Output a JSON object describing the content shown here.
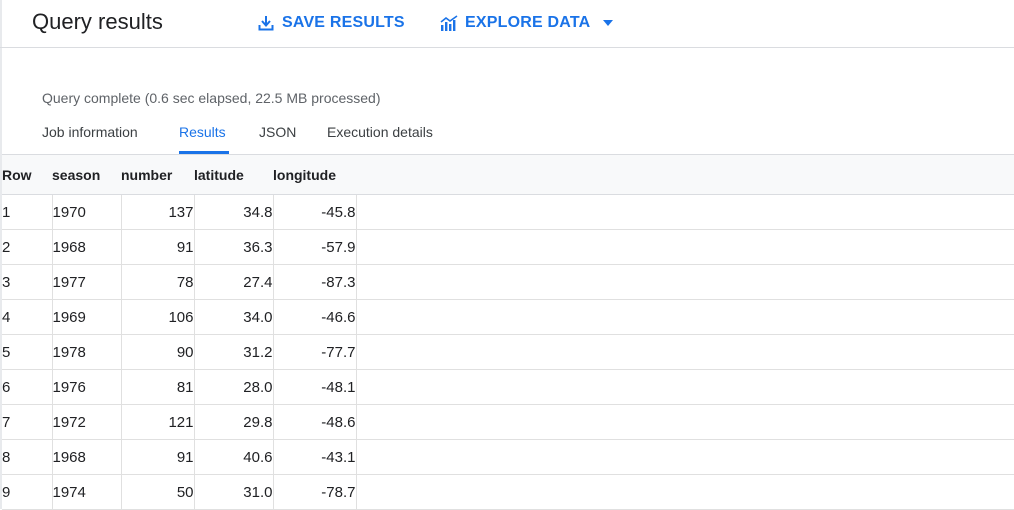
{
  "header": {
    "title": "Query results",
    "save_results_label": "SAVE RESULTS",
    "explore_data_label": "EXPLORE DATA"
  },
  "status": "Query complete (0.6 sec elapsed, 22.5 MB processed)",
  "tabs": [
    {
      "label": "Job information",
      "active": false
    },
    {
      "label": "Results",
      "active": true
    },
    {
      "label": "JSON",
      "active": false
    },
    {
      "label": "Execution details",
      "active": false
    }
  ],
  "table": {
    "columns": [
      "Row",
      "season",
      "number",
      "latitude",
      "longitude"
    ],
    "rows": [
      [
        "1",
        "1970",
        "137",
        "34.8",
        "-45.8"
      ],
      [
        "2",
        "1968",
        "91",
        "36.3",
        "-57.9"
      ],
      [
        "3",
        "1977",
        "78",
        "27.4",
        "-87.3"
      ],
      [
        "4",
        "1969",
        "106",
        "34.0",
        "-46.6"
      ],
      [
        "5",
        "1978",
        "90",
        "31.2",
        "-77.7"
      ],
      [
        "6",
        "1976",
        "81",
        "28.0",
        "-48.1"
      ],
      [
        "7",
        "1972",
        "121",
        "29.8",
        "-48.6"
      ],
      [
        "8",
        "1968",
        "91",
        "40.6",
        "-43.1"
      ],
      [
        "9",
        "1974",
        "50",
        "31.0",
        "-78.7"
      ]
    ]
  },
  "colors": {
    "accent": "#1a73e8",
    "text": "#202124",
    "secondary_text": "#5f6368",
    "header_bg": "#f8f9fa",
    "border": "#dadce0"
  },
  "icons": {
    "save": "download-icon",
    "explore": "chart-icon",
    "dropdown": "caret-down-icon"
  }
}
